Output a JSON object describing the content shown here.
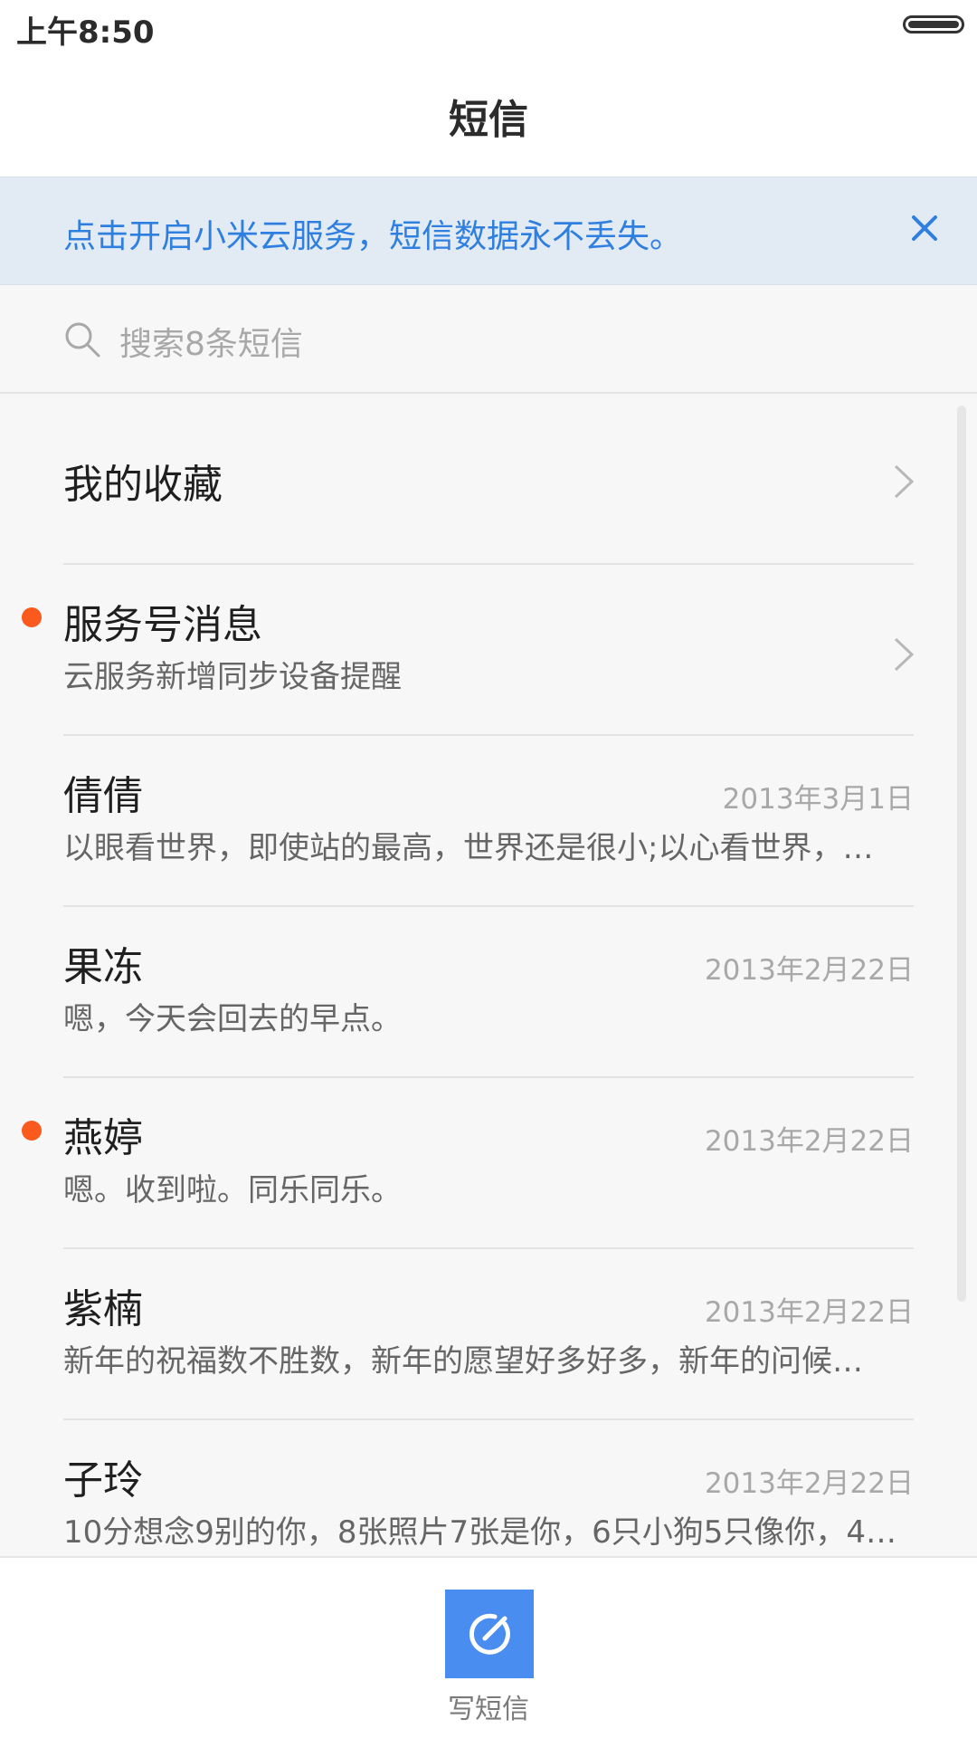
{
  "status_bar": {
    "time": "上午8:50"
  },
  "header": {
    "title": "短信"
  },
  "banner": {
    "text": "点击开启小米云服务，短信数据永不丢失。",
    "accent_color": "#2e7fe0"
  },
  "search": {
    "placeholder": "搜索8条短信"
  },
  "favorites": {
    "label": "我的收藏"
  },
  "service": {
    "name": "服务号消息",
    "preview": "云服务新增同步设备提醒",
    "unread": true
  },
  "conversations": [
    {
      "name": "倩倩",
      "date": "2013年3月1日",
      "preview": "以眼看世界，即使站的最高，世界还是很小;以心看世界，…",
      "unread": false
    },
    {
      "name": "果冻",
      "date": "2013年2月22日",
      "preview": "嗯，今天会回去的早点。",
      "unread": false
    },
    {
      "name": "燕婷",
      "date": "2013年2月22日",
      "preview": "嗯。收到啦。同乐同乐。",
      "unread": true
    },
    {
      "name": "紫楠",
      "date": "2013年2月22日",
      "preview": "新年的祝福数不胜数，新年的愿望好多好多，新年的问候…",
      "unread": false
    },
    {
      "name": "子玲",
      "date": "2013年2月22日",
      "preview": "10分想念9别的你，8张照片7张是你，6只小狗5只像你，4…",
      "unread": false
    }
  ],
  "compose": {
    "label": "写短信",
    "color": "#4a8df0"
  },
  "unread_color": "#fa5a1e"
}
